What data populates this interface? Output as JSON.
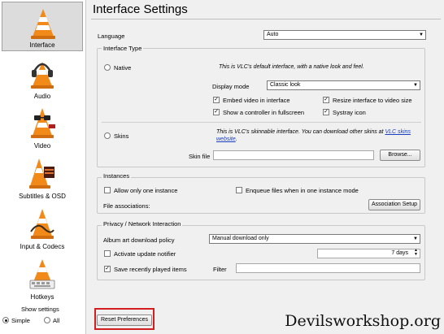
{
  "sidebar": {
    "items": [
      {
        "label": "Interface"
      },
      {
        "label": "Audio"
      },
      {
        "label": "Video"
      },
      {
        "label": "Subtitles & OSD"
      },
      {
        "label": "Input & Codecs"
      },
      {
        "label": "Hotkeys"
      }
    ],
    "show_settings": {
      "label": "Show settings",
      "simple": "Simple",
      "all": "All",
      "selected": "Simple"
    }
  },
  "header": {
    "title": "Interface Settings"
  },
  "language": {
    "label": "Language",
    "value": "Auto"
  },
  "interface_type": {
    "title": "Interface Type",
    "native": {
      "label": "Native",
      "desc": "This is VLC's default interface, with a native look and feel."
    },
    "display_mode": {
      "label": "Display mode",
      "value": "Classic look"
    },
    "embed_video": {
      "label": "Embed video in interface",
      "checked": true
    },
    "resize_interface": {
      "label": "Resize interface to video size",
      "checked": true
    },
    "show_controller": {
      "label": "Show a controller in fullscreen",
      "checked": true
    },
    "systray": {
      "label": "Systray icon",
      "checked": true
    },
    "skins": {
      "label": "Skins",
      "desc": "This is VLC's skinnable interface. You can download other skins at ",
      "link": "VLC skins website",
      "desc_end": "."
    },
    "skin_file": {
      "label": "Skin file",
      "value": ""
    },
    "browse": "Browse..."
  },
  "instances": {
    "title": "Instances",
    "one_instance": {
      "label": "Allow only one instance",
      "checked": false
    },
    "enqueue": {
      "label": "Enqueue files when in one instance mode",
      "checked": false
    },
    "associations": "File associations:",
    "association_setup": "Association Setup"
  },
  "privacy": {
    "title": "Privacy / Network Interaction",
    "album_art": {
      "label": "Album art download policy",
      "value": "Manual download only"
    },
    "update_notifier": {
      "label": "Activate update notifier",
      "checked": false
    },
    "days": "7 days",
    "save_recent": {
      "label": "Save recently played items",
      "checked": true
    },
    "filter": {
      "label": "Filter",
      "value": ""
    }
  },
  "footer": {
    "reset": "Reset Preferences"
  },
  "watermark": "Devilsworkshop.org",
  "colors": {
    "accent_orange": "#f28a1a",
    "highlight_red": "#d21e1e",
    "link_blue": "#1a3ec0"
  }
}
